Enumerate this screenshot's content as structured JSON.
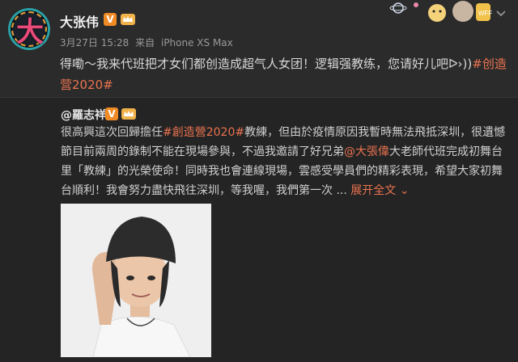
{
  "post": {
    "username": "大张伟",
    "date": "3月27日 15:28",
    "source_prefix": "来自",
    "device": "iPhone XS Max",
    "text": "得嘞～我来代班把才女们都创造成超气人女团！逻辑强教练，您请好儿吧",
    "hashtag": "#创造营2020#",
    "icons": [
      "avatar",
      "verified-badge",
      "crown-icon",
      "chevron-down-icon",
      "decoration-sticker"
    ]
  },
  "repost": {
    "username": "@羅志祥",
    "text_part1": "很高興這次回歸擔任",
    "hashtag": "#創造營2020#",
    "text_part2": "教練，但由於疫情原因我暫時無法飛抵深圳，很遺憾節目前兩周的錄制不能在現場參與，不過我邀請了好兄弟",
    "mention": "@大張偉",
    "text_part3": "大老師代班完成初舞台里「教練」的光榮使命！同時我也會連線現場，雲感受學員們的精彩表現，希望大家初舞台順利！我會努力盡快飛往深圳，等我喔，我們第一次 ...",
    "expand_label": "展开全文",
    "photo": "photo-man-beanie"
  },
  "colors": {
    "accent": "#eb7350",
    "background": "#2a2a2a",
    "badge": "#f08a24"
  }
}
